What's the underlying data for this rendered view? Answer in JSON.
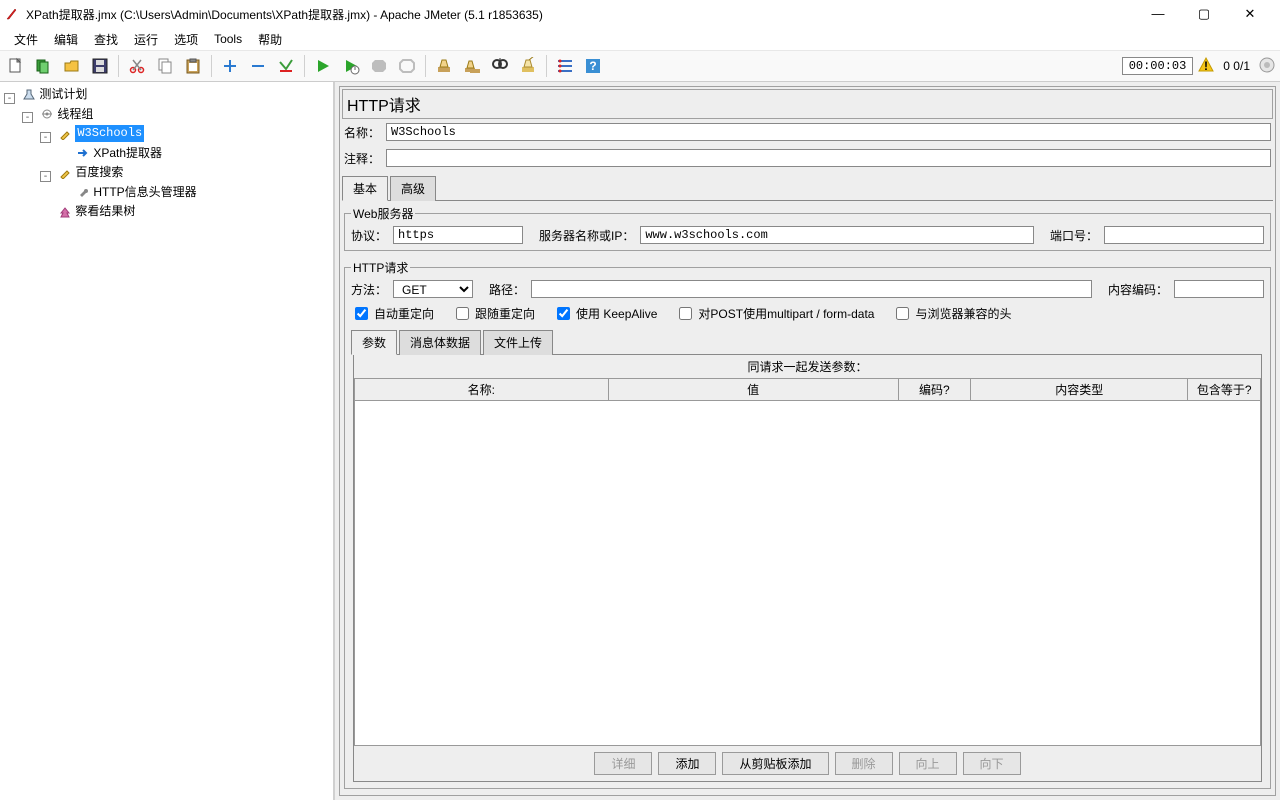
{
  "window": {
    "title": "XPath提取器.jmx (C:\\Users\\Admin\\Documents\\XPath提取器.jmx) - Apache JMeter (5.1 r1853635)"
  },
  "menu": {
    "items": [
      "文件",
      "编辑",
      "查找",
      "运行",
      "选项",
      "Tools",
      "帮助"
    ]
  },
  "status": {
    "time": "00:00:03",
    "runcount": "0  0/1"
  },
  "tree": {
    "root": "测试计划",
    "threadGroup": "线程组",
    "w3": "W3Schools",
    "xpath": "XPath提取器",
    "baidu": "百度搜索",
    "header": "HTTP信息头管理器",
    "results": "察看结果树"
  },
  "panel": {
    "title": "HTTP请求",
    "labels": {
      "name": "名称：",
      "comment": "注释：",
      "tabBasic": "基本",
      "tabAdv": "高级",
      "webServer": "Web服务器",
      "protocol": "协议：",
      "serverName": "服务器名称或IP：",
      "port": "端口号：",
      "httpReq": "HTTP请求",
      "method": "方法：",
      "path": "路径：",
      "contentEnc": "内容编码："
    },
    "values": {
      "name": "W3Schools",
      "comment": "",
      "protocol": "https",
      "server": "www.w3schools.com",
      "port": "",
      "method": "GET",
      "path": "",
      "contentEnc": ""
    },
    "checkboxes": {
      "autoRedirect": "自动重定向",
      "followRedirect": "跟随重定向",
      "keepAlive": "使用 KeepAlive",
      "multipart": "对POST使用multipart / form-data",
      "browserHeaders": "与浏览器兼容的头"
    },
    "checkValues": {
      "autoRedirect": true,
      "followRedirect": false,
      "keepAlive": true,
      "multipart": false,
      "browserHeaders": false
    },
    "subtabs": {
      "params": "参数",
      "body": "消息体数据",
      "files": "文件上传"
    },
    "paramTitle": "同请求一起发送参数：",
    "paramCols": {
      "name": "名称:",
      "value": "值",
      "encode": "编码?",
      "ctype": "内容类型",
      "equals": "包含等于?"
    },
    "buttons": {
      "detail": "详细",
      "add": "添加",
      "clip": "从剪贴板添加",
      "del": "删除",
      "up": "向上",
      "down": "向下"
    }
  }
}
